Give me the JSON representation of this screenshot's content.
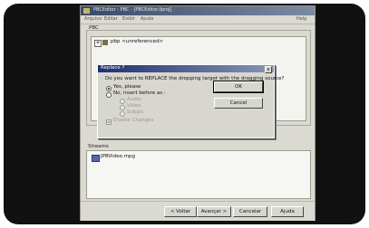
{
  "window": {
    "title": "PBCEditor - PBC - [PBCEditor.ilproj]",
    "menu": [
      "Arquivo",
      "Editar",
      "Exibir",
      "Ajuda"
    ],
    "menu_right": "Help"
  },
  "pbc_panel": {
    "label": "PBC",
    "tree_expander": "+",
    "tree_item": "pbp <unreferenced>"
  },
  "dialog": {
    "title": "Replace ?",
    "close": "x",
    "question": "Do you want to REPLACE the dropping target with the dragging source?",
    "option_yes": "Yes, please",
    "option_no": "No, insert before as :",
    "sub_options": [
      "Audio",
      "Video",
      "Subpic"
    ],
    "checkbox_label": "Enable Changes",
    "ok_label": "OK",
    "cancel_label": "Cancel"
  },
  "streams_panel": {
    "label": "Streams",
    "item": "JPBVideo.mpg"
  },
  "wizard_buttons": {
    "back": "< Voltar",
    "next": "Avançar >",
    "cancel": "Cancelar",
    "help": "Ajuda"
  }
}
